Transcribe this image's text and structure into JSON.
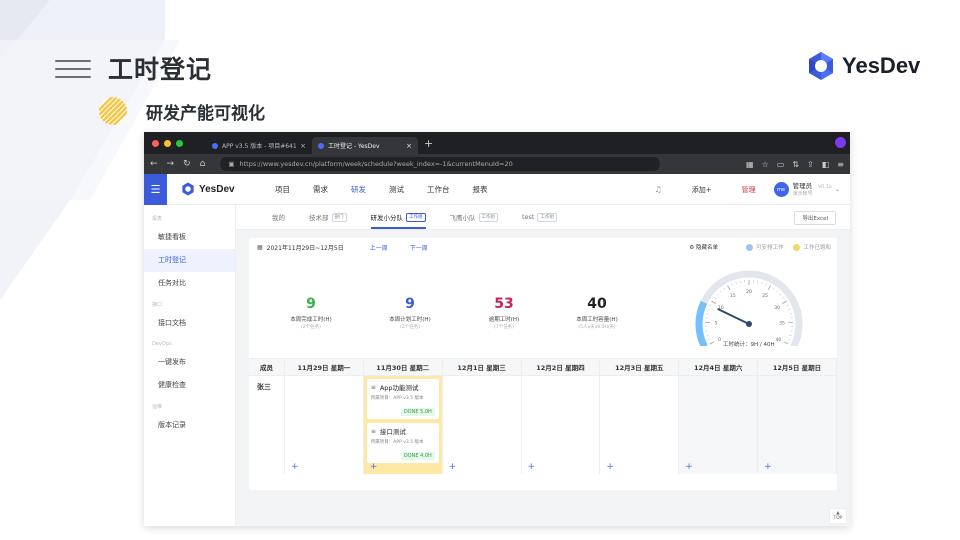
{
  "slide": {
    "title": "工时登记",
    "subtitle": "研发产能可视化",
    "brand": "YesDev"
  },
  "browser": {
    "tabs": [
      {
        "label": "APP v3.5 版本 - 项目#6417 - Yes",
        "close": "×"
      },
      {
        "label": "工时登记 - YesDev",
        "close": "×"
      }
    ],
    "new_tab": "+",
    "url_host": "https://www.yesdev.cn",
    "url_path": "/platform/week/schedule?week_index=-1&currentMenuId=20"
  },
  "app": {
    "logo": "YesDev",
    "nav": [
      "项目",
      "需求",
      "研发",
      "测试",
      "工作台",
      "报表"
    ],
    "nav_active_index": 2,
    "add_label": "添加+",
    "manage_label": "管理",
    "user": {
      "avatar": "me",
      "name": "管理员",
      "role": "演示账号",
      "version": "v0.1x"
    },
    "sidebar": [
      {
        "group": "报表",
        "items": [
          "敏捷看板",
          "工时登记",
          "任务对比"
        ]
      },
      {
        "group": "接口",
        "items": [
          "接口文档"
        ]
      },
      {
        "group": "DevOps",
        "items": [
          "一键发布",
          "健康检查"
        ]
      },
      {
        "group": "运维",
        "items": [
          "版本记录"
        ]
      }
    ],
    "sidebar_active": "工时登记",
    "team_tabs": [
      {
        "label": "我的",
        "tag": ""
      },
      {
        "label": "技术部",
        "tag": "部门"
      },
      {
        "label": "研发小分队",
        "tag": "工作组"
      },
      {
        "label": "飞鹰小队",
        "tag": "工作组"
      },
      {
        "label": "test",
        "tag": "工作组"
      }
    ],
    "team_tab_active": 2,
    "export_label": "导出Excel"
  },
  "schedule": {
    "range": "2021年11月29日~12月5日",
    "prev_week": "上一周",
    "next_week": "下一周",
    "hide_list": "隐藏名单",
    "legend": [
      {
        "label": "可安排工作",
        "color": "#9cc3f0"
      },
      {
        "label": "工作已饱和",
        "color": "#f5d56a"
      }
    ],
    "stats": [
      {
        "value": "9",
        "label": "本周完成工时(H)",
        "sub": "(2个任务)",
        "color": "#37b24d"
      },
      {
        "value": "9",
        "label": "本周计划工时(H)",
        "sub": "(2个任务)",
        "color": "#3b5bdb"
      },
      {
        "value": "53",
        "label": "逾期工时(H)",
        "sub": "(7个任务)",
        "color": "#c2255c"
      },
      {
        "value": "40",
        "label": "本周工时容量(H)",
        "sub": "(5人x天x8.0H/天)",
        "color": "#222222"
      }
    ],
    "gauge": {
      "label": "工时统计：9H / 40H",
      "value": 9,
      "max": 40,
      "ticks": [
        "0",
        "5",
        "10",
        "15",
        "20",
        "25",
        "30",
        "35",
        "40"
      ]
    },
    "member_header": "成员",
    "days": [
      "11月29日 星期一",
      "11月30日 星期二",
      "12月1日 星期三",
      "12月2日 星期四",
      "12月3日 星期五",
      "12月4日 星期六",
      "12月5日 星期日"
    ],
    "member": "张三",
    "tasks": [
      {
        "title": "App功能测试",
        "project": "所属项目：APP v3.5 版本",
        "status": "DONE 5.0H"
      },
      {
        "title": "接口测试",
        "project": "所属项目：APP v3.5 版本",
        "status": "DONE 4.0H"
      }
    ],
    "add_symbol": "+",
    "top_label": "TOP"
  }
}
